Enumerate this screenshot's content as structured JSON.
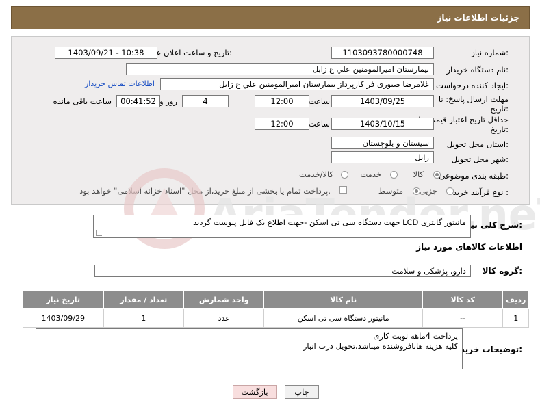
{
  "header": {
    "title": "جزئیات اطلاعات نیاز"
  },
  "form": {
    "need_number_label": "شماره نیاز:",
    "need_number": "1103093780000748",
    "announce_label": "تاریخ و ساعت اعلان عمومی:",
    "announce_value": "1403/09/21 - 10:38",
    "buyer_org_label": "نام دستگاه خریدار:",
    "buyer_org": "بیمارستان امیرالمومنین علي  ع  زابل",
    "creator_label": "ایجاد کننده درخواست:",
    "creator": "غلامرضا صبوری فر کارپرداز بیمارستان امیرالمومنین علي  ع  زابل",
    "contact_link": "اطلاعات تماس خریدار",
    "deadline_label_1": "مهلت ارسال پاسخ: تا",
    "deadline_label_2": "تاریخ:",
    "deadline_date": "1403/09/25",
    "time_label": "ساعت",
    "deadline_time": "12:00",
    "days_value": "4",
    "days_label": "روز و",
    "remaining_time": "00:41:52",
    "remaining_label": "ساعت باقی مانده",
    "validity_label_1": "حداقل تاریخ اعتبار قیمت: تا",
    "validity_label_2": "تاریخ:",
    "validity_date": "1403/10/15",
    "validity_time": "12:00",
    "province_label": "استان محل تحویل:",
    "province": "سیستان و بلوچستان",
    "city_label": "شهر محل تحویل:",
    "city": "زابل",
    "category_label": "طبقه بندی موضوعی:",
    "category_options": [
      "کالا",
      "خدمت",
      "کالا/خدمت"
    ],
    "purchase_type_label": "نوع فرآیند خرید :",
    "purchase_options": [
      "جزیی",
      "متوسط"
    ],
    "payment_note": "پرداخت تمام یا بخشی از مبلغ خرید،از محل \"اسناد خزانه اسلامی\" خواهد بود."
  },
  "description": {
    "label": "شرح کلی نیاز:",
    "text": "مانیتور گانتری LCD جهت دستگاه سی تی اسکن -جهت اطلاع یک فایل پیوست گردید"
  },
  "goods_info": {
    "title": "اطلاعات کالاهای مورد نیاز",
    "group_label": "گروه کالا:",
    "group_value": "دارو، پزشکی و سلامت"
  },
  "table": {
    "headers": [
      "ردیف",
      "کد کالا",
      "نام کالا",
      "واحد شمارش",
      "تعداد / مقدار",
      "تاریخ نیاز"
    ],
    "rows": [
      [
        "1",
        "--",
        "مانیتور دستگاه سی تی اسکن",
        "عدد",
        "1",
        "1403/09/29"
      ]
    ]
  },
  "buyer_notes": {
    "label": "توضیحات خریدار:",
    "line1": "پرداخت 4ماهه نوبت کاری",
    "line2": "کلیه هزینه هابافروشنده میباشد،تحویل درب انبار"
  },
  "buttons": {
    "print": "چاپ",
    "back": "بازگشت"
  },
  "watermark": {
    "text": "AriaTender.neT"
  },
  "colors": {
    "title_bar": "#8b6f47",
    "table_header": "#8d8d8d",
    "link": "#1a4fc4"
  }
}
